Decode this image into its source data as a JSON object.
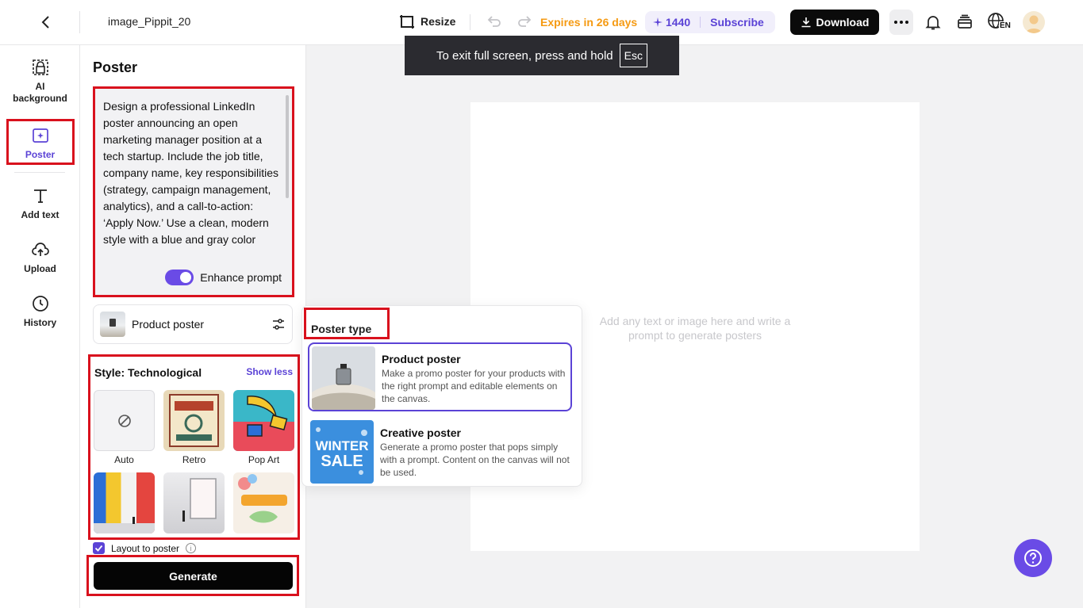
{
  "topbar": {
    "filename": "image_Pippit_20",
    "resize_label": "Resize",
    "expires": "Expires in 26 days",
    "credits": "1440",
    "subscribe": "Subscribe",
    "download": "Download",
    "language": "EN"
  },
  "toast": {
    "text": "To exit full screen, press and hold",
    "key": "Esc"
  },
  "leftnav": {
    "items": [
      {
        "label": "AI background",
        "icon": "ai-background-icon"
      },
      {
        "label": "Poster",
        "icon": "poster-icon",
        "active": true
      },
      {
        "label": "Add text",
        "icon": "text-icon"
      },
      {
        "label": "Upload",
        "icon": "upload-icon"
      },
      {
        "label": "History",
        "icon": "history-icon"
      }
    ]
  },
  "panel": {
    "title": "Poster",
    "prompt": "Design a professional LinkedIn poster announcing an open marketing manager position at a tech startup. Include the job title, company name, key responsibilities (strategy, campaign management, analytics), and a call-to-action: ‘Apply Now.’ Use a clean, modern style with a blue and gray color",
    "enhance_label": "Enhance prompt",
    "enhance_on": true,
    "poster_type": "Product poster",
    "style_heading": "Style: Technological",
    "show_less": "Show less",
    "styles": [
      "Auto",
      "Retro",
      "Pop Art",
      "",
      "",
      ""
    ],
    "layout_label": "Layout to poster",
    "layout_checked": true,
    "generate": "Generate"
  },
  "canvas": {
    "hint": "Add any text or image here and write a prompt to generate posters"
  },
  "popup": {
    "title": "Poster type",
    "types": [
      {
        "title": "Product poster",
        "desc": "Make a promo poster for your products with the right prompt and editable elements on the canvas.",
        "selected": true
      },
      {
        "title": "Creative poster",
        "desc": "Generate a promo poster that pops simply with a prompt. Content on the canvas will not be used.",
        "thumb_text_1": "WINTER",
        "thumb_text_2": "SALE"
      }
    ]
  },
  "colors": {
    "accent": "#5b43d6",
    "expires": "#f59a12",
    "highlight_box": "#d9111d"
  }
}
